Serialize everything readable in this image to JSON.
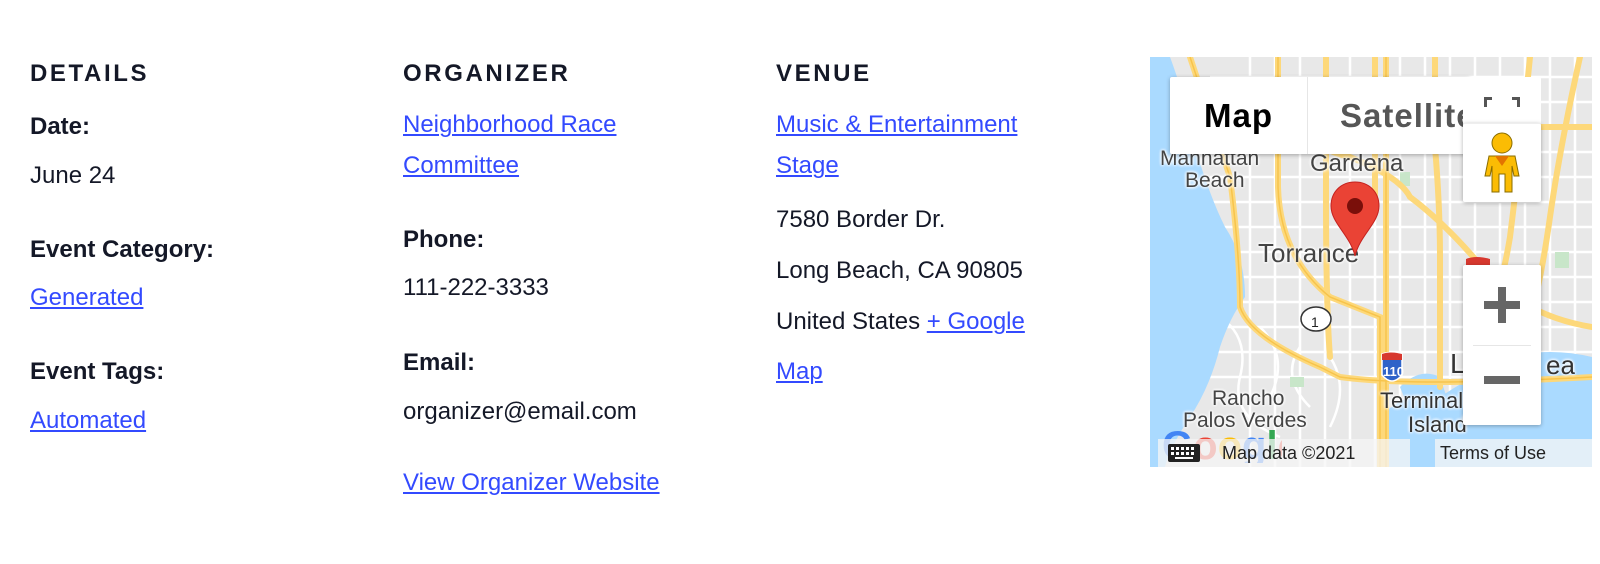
{
  "details": {
    "title": "DETAILS",
    "date_label": "Date:",
    "date_value": "June 24",
    "category_label": "Event Category:",
    "category_link": "Generated",
    "tags_label": "Event Tags:",
    "tags_link": "Automated"
  },
  "organizer": {
    "title": "ORGANIZER",
    "name_line1": "Neighborhood Race",
    "name_line2": "Committee",
    "phone_label": "Phone:",
    "phone_value": "111-222-3333",
    "email_label": "Email:",
    "email_value": "organizer@email.com",
    "website_link": "View Organizer Website"
  },
  "venue": {
    "title": "VENUE",
    "name_line1": "Music & Entertainment",
    "name_line2": "Stage",
    "address_line1": "7580 Border Dr.",
    "address_line2": "Long Beach, CA 90805",
    "country": "United States",
    "gmap_link_line1": "+ Google",
    "gmap_link_line2": "Map"
  },
  "map": {
    "type_buttons": [
      "Map",
      "Satellite"
    ],
    "selected_type": "Map",
    "labels": {
      "manhattan": "Manhattan",
      "beach": "Beach",
      "gardena": "Gardena",
      "torrance": "Torrance",
      "rancho": "Rancho",
      "palos_verdes": "Palos Verdes",
      "terminal": "Terminal",
      "island": "Island",
      "long_beach_partial": "L",
      "ea_partial": "ea",
      "route_1": "1",
      "interstate_110": "110"
    },
    "attribution": "Map data ©2021",
    "terms": "Terms of Use",
    "colors": {
      "water": "#aadaff",
      "land": "#e8e8e8",
      "highway": "#fdd87a",
      "marker": "#ea4335",
      "marker_dot": "#7a0f0a",
      "pegman": "#fbbc04"
    },
    "icons": {
      "fullscreen": "fullscreen-icon",
      "pegman": "street-view-pegman-icon",
      "zoom_in": "plus-icon",
      "zoom_out": "minus-icon",
      "keyboard": "keyboard-icon",
      "marker": "map-marker-icon",
      "logo": "google-logo"
    }
  }
}
